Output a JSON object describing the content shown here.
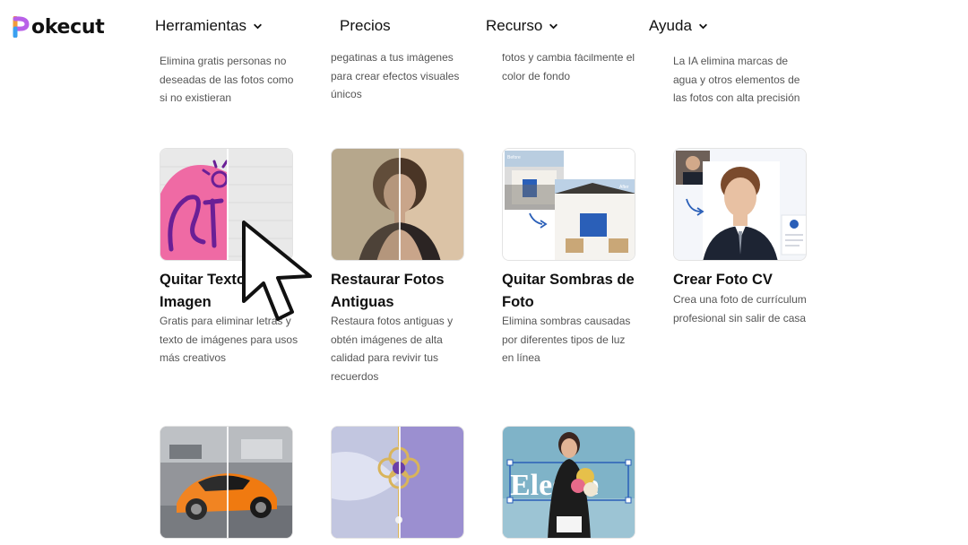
{
  "brand": {
    "name": "okecut",
    "full_name": "Pokecut"
  },
  "nav": [
    {
      "label": "Herramientas",
      "has_dropdown": true
    },
    {
      "label": "Precios",
      "has_dropdown": false
    },
    {
      "label": "Recurso",
      "has_dropdown": true
    },
    {
      "label": "Ayuda",
      "has_dropdown": true
    }
  ],
  "top_row": [
    {
      "desc": [
        "Elimina gratis personas no",
        "deseadas de las fotos como",
        "si no existieran"
      ]
    },
    {
      "desc": [
        "pegatinas a tus imágenes",
        "para crear efectos visuales",
        "únicos"
      ]
    },
    {
      "desc": [
        "fotos y cambia fácilmente el",
        "color de fondo"
      ]
    },
    {
      "desc": [
        "La IA elimina marcas de",
        "agua y otros elementos de",
        "las fotos con alta precisión"
      ]
    }
  ],
  "tools": [
    {
      "title": [
        "Quitar Texto",
        "Imagen"
      ],
      "desc": [
        "Gratis para eliminar letras y",
        "texto de imágenes para usos",
        "más creativos"
      ]
    },
    {
      "title": [
        "Restaurar Fotos",
        "Antiguas"
      ],
      "desc": [
        "Restaura fotos antiguas y",
        "obtén imágenes de alta",
        "calidad para revivir tus",
        "recuerdos"
      ]
    },
    {
      "title": [
        "Quitar Sombras de",
        "Foto"
      ],
      "desc": [
        "Elimina sombras causadas",
        "por diferentes tipos de luz",
        "en línea"
      ]
    },
    {
      "title": [
        "Crear Foto CV"
      ],
      "desc": [
        "Crea una foto de currículum",
        "profesional sin salir de casa"
      ]
    }
  ],
  "thumb_labels": {
    "before": "Before",
    "after": "After"
  },
  "bottom_row": [
    {
      "image": "car-photo"
    },
    {
      "image": "jewelry-photo"
    },
    {
      "image": "woman-flowers-photo",
      "overlay_text": "Eleg te"
    }
  ],
  "colors": {
    "accent_pink": "#ef6aa4",
    "accent_blue": "#2a5fb8",
    "text_dark": "#111111",
    "text_gray": "#555555"
  }
}
